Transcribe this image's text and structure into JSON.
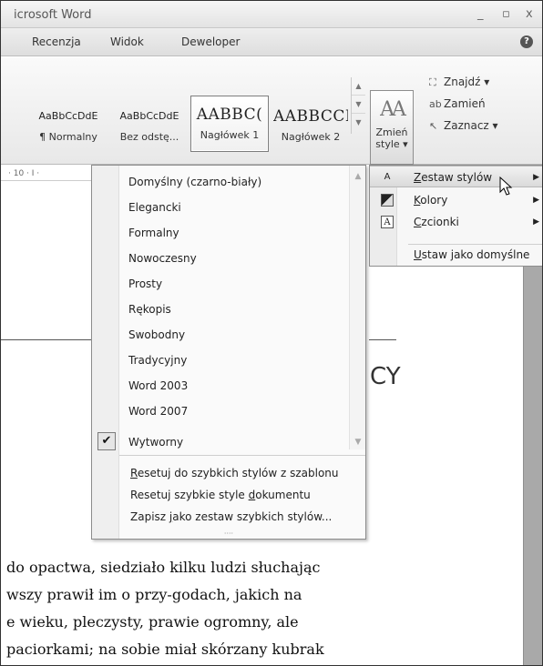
{
  "window": {
    "title": "icrosoft Word",
    "minimize": "_",
    "maximize": "▫",
    "close": "x"
  },
  "tabs": [
    "Recenzja",
    "Widok",
    "Deweloper"
  ],
  "help": "?",
  "styles_gallery": [
    {
      "sample": "AaBbCcDdE",
      "name": "¶ Normalny"
    },
    {
      "sample": "AaBbCcDdE",
      "name": "Bez odstę..."
    },
    {
      "sample": "AABBC(",
      "name": "Nagłówek 1"
    },
    {
      "sample": "AABBCCI",
      "name": "Nagłówek 2"
    }
  ],
  "change_styles": {
    "glyph": "AA",
    "line1": "Zmień",
    "line2": "style ▾"
  },
  "editing": {
    "find": "Znajdź ▾",
    "replace": "Zamień",
    "select": "Zaznacz ▾"
  },
  "ruler": "· 10 · I ·",
  "style_sets": [
    "Domyślny (czarno-biały)",
    "Elegancki",
    "Formalny",
    "Nowoczesny",
    "Prosty",
    "Rękopis",
    "Swobodny",
    "Tradycyjny",
    "Word 2003",
    "Word 2007",
    "Wytworny"
  ],
  "checked_item": "Wytworny",
  "commands": {
    "reset_template": {
      "u": "R",
      "rest": "esetuj do szybkich stylów z szablonu"
    },
    "reset_doc": {
      "pre": "Resetuj szybkie style ",
      "u": "d",
      "rest": "okumentu"
    },
    "save_as": {
      "pre": "Zapisz ",
      "u": "j",
      "rest": "ako zestaw szybkich stylów..."
    }
  },
  "submenu": [
    {
      "u": "Z",
      "rest": "estaw stylów",
      "arrow": "▶"
    },
    {
      "u": "K",
      "rest": "olory",
      "arrow": "▶"
    },
    {
      "u": "C",
      "rest": "zcionki",
      "arrow": "▶"
    },
    {
      "u": "U",
      "rest": "staw jako domyślne",
      "arrow": ""
    }
  ],
  "document": {
    "heading_fragment": "CY",
    "paragraph": [
      "do opactwa, siedziało kilku ludzi słuchając",
      "wszy prawił im o przy-godach, jakich na",
      "e wieku, pleczysty, prawie ogromny, ale",
      "paciorkami; na sobie miał skórzany kubrak"
    ]
  }
}
